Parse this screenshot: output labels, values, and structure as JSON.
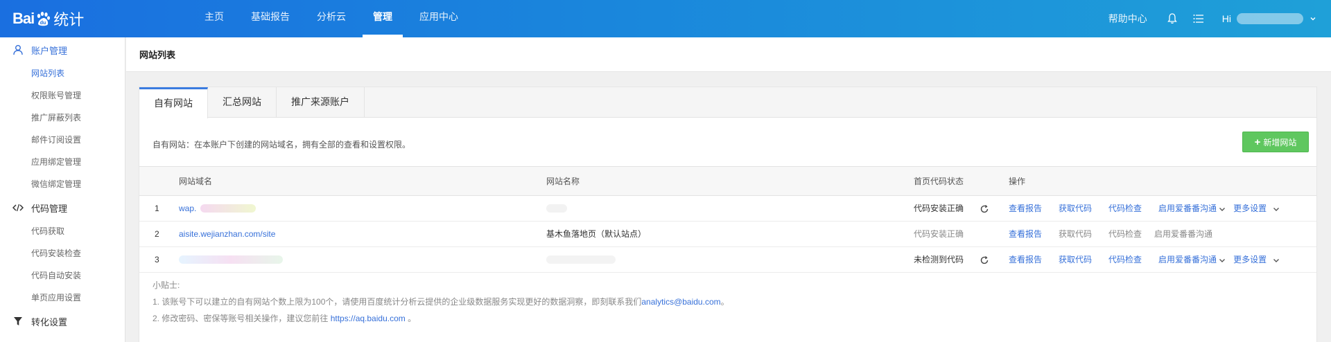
{
  "brand": {
    "logo_left": "Bai",
    "logo_du": "du",
    "logo_right": "统计"
  },
  "nav": {
    "items": [
      {
        "label": "主页",
        "active": false
      },
      {
        "label": "基础报告",
        "active": false
      },
      {
        "label": "分析云",
        "active": false
      },
      {
        "label": "管理",
        "active": true
      },
      {
        "label": "应用中心",
        "active": false
      }
    ]
  },
  "topright": {
    "help": "帮助中心",
    "hi": "Hi"
  },
  "sidebar": {
    "groups": [
      {
        "label": "账户管理",
        "icon": "user-icon",
        "active": true,
        "items": [
          {
            "label": "网站列表",
            "active": true
          },
          {
            "label": "权限账号管理",
            "active": false
          },
          {
            "label": "推广屏蔽列表",
            "active": false
          },
          {
            "label": "邮件订阅设置",
            "active": false
          },
          {
            "label": "应用绑定管理",
            "active": false
          },
          {
            "label": "微信绑定管理",
            "active": false
          }
        ]
      },
      {
        "label": "代码管理",
        "icon": "code-icon",
        "active": false,
        "items": [
          {
            "label": "代码获取",
            "active": false
          },
          {
            "label": "代码安装检查",
            "active": false
          },
          {
            "label": "代码自动安装",
            "active": false
          },
          {
            "label": "单页应用设置",
            "active": false
          }
        ]
      },
      {
        "label": "转化设置",
        "icon": "filter-icon",
        "active": false,
        "items": []
      }
    ]
  },
  "page": {
    "title": "网站列表"
  },
  "tabs": [
    {
      "label": "自有网站",
      "active": true
    },
    {
      "label": "汇总网站",
      "active": false
    },
    {
      "label": "推广来源账户",
      "active": false
    }
  ],
  "description": "自有网站：在本账户下创建的网站域名，拥有全部的查看和设置权限。",
  "add_button": {
    "plus": "+",
    "label": "新增网站"
  },
  "table": {
    "headers": {
      "domain": "网站域名",
      "name": "网站名称",
      "status": "首页代码状态",
      "ops": "操作"
    },
    "rows": [
      {
        "index": "1",
        "domain": "wap.",
        "name": "",
        "status": "代码安装正确",
        "status_active": true,
        "ops": {
          "report": "查看报告",
          "code": "获取代码",
          "check": "代码检查",
          "aifanfan": "启用爱番番沟通",
          "more": "更多设置"
        }
      },
      {
        "index": "2",
        "domain": "aisite.wejianzhan.com/site",
        "name": "基木鱼落地页（默认站点）",
        "status": "代码安装正确",
        "status_active": false,
        "ops": {
          "report": "查看报告",
          "code": "获取代码",
          "check": "代码检查",
          "aifanfan": "启用爱番番沟通",
          "more": ""
        }
      },
      {
        "index": "3",
        "domain": "",
        "name": "",
        "status": "未检测到代码",
        "status_active": true,
        "ops": {
          "report": "查看报告",
          "code": "获取代码",
          "check": "代码检查",
          "aifanfan": "启用爱番番沟通",
          "more": "更多设置"
        }
      }
    ]
  },
  "tips": {
    "title": "小贴士:",
    "line1_prefix": "1. 该账号下可以建立的自有网站个数上限为100个，请使用百度统计分析云提供的企业级数据服务实现更好的数据洞察，即刻联系我们",
    "line1_link": "analytics@baidu.com",
    "line1_suffix": "。",
    "line2_prefix": "2. 修改密码、密保等账号相关操作，建议您前往",
    "line2_link": "https://aq.baidu.com",
    "line2_suffix": "。"
  },
  "colors": {
    "accent": "#3670d9",
    "nav_start": "#1a6fe0",
    "nav_end": "#1fa0d8",
    "add_button": "#5fc75f"
  }
}
